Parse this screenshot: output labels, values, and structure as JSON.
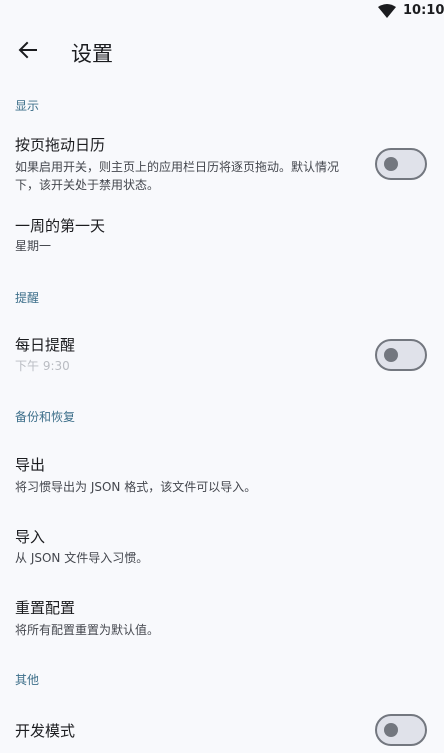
{
  "status_bar": {
    "time": "10:10",
    "wifi_icon": "wifi-icon"
  },
  "app_bar": {
    "title": "设置",
    "back_icon": "arrow-back-icon"
  },
  "sections": {
    "display": {
      "header": "显示",
      "page_calendar": {
        "title": "按页拖动日历",
        "description": "如果启用开关，则主页上的应用栏日历将逐页拖动。默认情况下，该开关处于禁用状态。",
        "enabled": false
      },
      "first_day": {
        "title": "一周的第一天",
        "value": "星期一"
      }
    },
    "reminder": {
      "header": "提醒",
      "daily_reminder": {
        "title": "每日提醒",
        "time": "下午 9:30",
        "enabled": false
      }
    },
    "backup": {
      "header": "备份和恢复",
      "export": {
        "title": "导出",
        "description": "将习惯导出为 JSON 格式，该文件可以导入。"
      },
      "import": {
        "title": "导入",
        "description": "从 JSON 文件导入习惯。"
      },
      "reset": {
        "title": "重置配置",
        "description": "将所有配置重置为默认值。"
      }
    },
    "other": {
      "header": "其他",
      "developer_mode": {
        "title": "开发模式",
        "enabled": false
      }
    }
  },
  "colors": {
    "background": "#f8f9fc",
    "section_header": "#3d6f8a",
    "switch_outline": "#73777f",
    "switch_track": "#e0e2ea"
  }
}
